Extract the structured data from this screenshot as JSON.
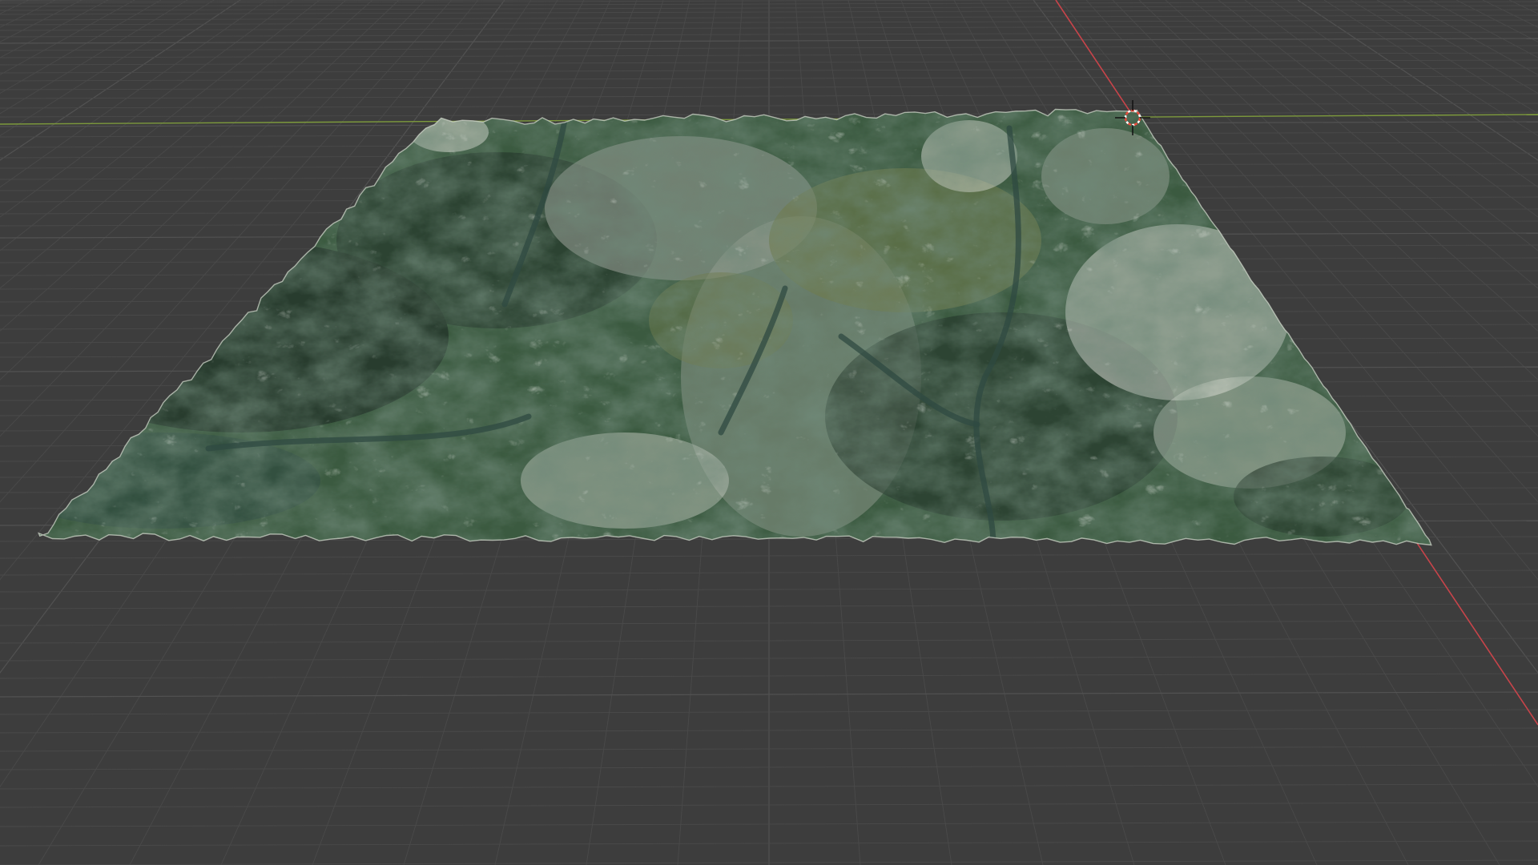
{
  "viewport": {
    "kind": "3d-viewport",
    "background_color": "#3d3d3d",
    "grid_line_color": "#4a4a4a",
    "grid_major_color": "#525252",
    "x_axis_color": "#c8444a",
    "y_axis_color": "#7d9a3c",
    "cursor_name": "3d-cursor-icon"
  },
  "object": {
    "kind": "terrain-mesh",
    "material": "satellite-imagery",
    "colors": {
      "forest_dark": "#27392c",
      "forest": "#3b5a40",
      "meadow": "#6f7b4d",
      "rock": "#9ea39a",
      "snow": "#d5d7cf",
      "valley": "#2f4a41",
      "edge": "#cfd5c9"
    }
  }
}
